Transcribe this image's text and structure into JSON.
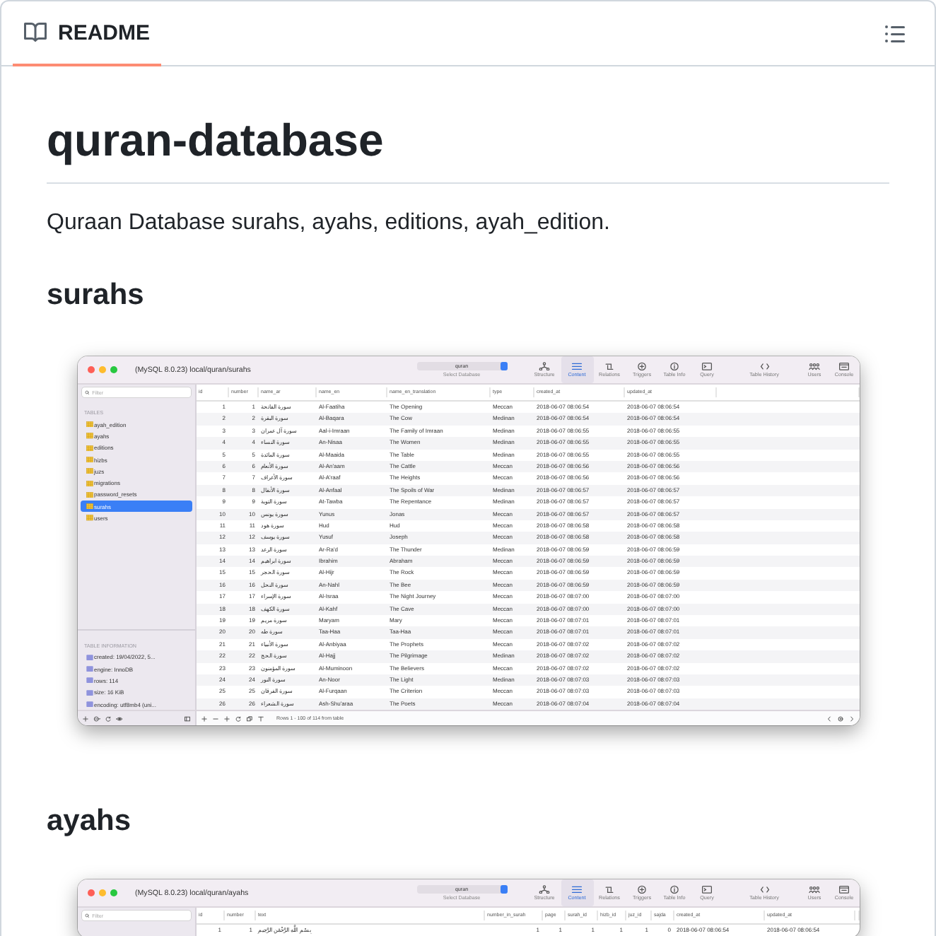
{
  "tab": {
    "label": "README",
    "selected": true
  },
  "readme": {
    "title": "quran-database",
    "description": "Quraan Database surahs, ayahs, editions, ayah_edition.",
    "sections": [
      {
        "heading": "surahs",
        "screenshot": {
          "title": "(MySQL 8.0.23) local/quran/surahs",
          "database": "quran",
          "database_label": "Select Database",
          "toolbar": [
            {
              "label": "Structure",
              "kind": "structure",
              "selected": false
            },
            {
              "label": "Content",
              "kind": "content",
              "selected": true
            },
            {
              "label": "Relations",
              "kind": "relations",
              "selected": false
            },
            {
              "label": "Triggers",
              "kind": "triggers",
              "selected": false
            },
            {
              "label": "Table Info",
              "kind": "info",
              "selected": false
            },
            {
              "label": "Query",
              "kind": "query",
              "selected": false
            },
            {
              "label": "Table History",
              "kind": "history",
              "selected": false
            },
            {
              "label": "Users",
              "kind": "users",
              "selected": false
            },
            {
              "label": "Console",
              "kind": "console",
              "selected": false
            }
          ],
          "filter_placeholder": "Filter",
          "tables_heading": "TABLES",
          "tables": [
            {
              "name": "ayah_edition",
              "selected": false
            },
            {
              "name": "ayahs",
              "selected": false
            },
            {
              "name": "editions",
              "selected": false
            },
            {
              "name": "hizbs",
              "selected": false
            },
            {
              "name": "juzs",
              "selected": false
            },
            {
              "name": "migrations",
              "selected": false
            },
            {
              "name": "password_resets",
              "selected": false
            },
            {
              "name": "surahs",
              "selected": true
            },
            {
              "name": "users",
              "selected": false
            }
          ],
          "info_heading": "TABLE INFORMATION",
          "info": [
            "created: 19/04/2022, 5...",
            "engine: InnoDB",
            "rows: 114",
            "size: 16 KiB",
            "encoding: utf8mb4 (uni..."
          ],
          "columns": [
            "id",
            "number",
            "name_ar",
            "name_en",
            "name_en_translation",
            "type",
            "created_at",
            "updated_at"
          ],
          "rows": [
            [
              "1",
              "1",
              "سورة الفاتحة",
              "Al-Faatiha",
              "The Opening",
              "Meccan",
              "2018-06-07 08:06:54",
              "2018-06-07 08:06:54"
            ],
            [
              "2",
              "2",
              "سورة البقرة",
              "Al-Baqara",
              "The Cow",
              "Medinan",
              "2018-06-07 08:06:54",
              "2018-06-07 08:06:54"
            ],
            [
              "3",
              "3",
              "سورة آل عمران",
              "Aal-i-Imraan",
              "The Family of Imraan",
              "Medinan",
              "2018-06-07 08:06:55",
              "2018-06-07 08:06:55"
            ],
            [
              "4",
              "4",
              "سورة النساء",
              "An-Nisaa",
              "The Women",
              "Medinan",
              "2018-06-07 08:06:55",
              "2018-06-07 08:06:55"
            ],
            [
              "5",
              "5",
              "سورة المائدة",
              "Al-Maaida",
              "The Table",
              "Medinan",
              "2018-06-07 08:06:55",
              "2018-06-07 08:06:55"
            ],
            [
              "6",
              "6",
              "سورة الأنعام",
              "Al-An'aam",
              "The Cattle",
              "Meccan",
              "2018-06-07 08:06:56",
              "2018-06-07 08:06:56"
            ],
            [
              "7",
              "7",
              "سورة الأعراف",
              "Al-A'raaf",
              "The Heights",
              "Meccan",
              "2018-06-07 08:06:56",
              "2018-06-07 08:06:56"
            ],
            [
              "8",
              "8",
              "سورة الأنفال",
              "Al-Anfaal",
              "The Spoils of War",
              "Medinan",
              "2018-06-07 08:06:57",
              "2018-06-07 08:06:57"
            ],
            [
              "9",
              "9",
              "سورة التوبة",
              "At-Tawba",
              "The Repentance",
              "Medinan",
              "2018-06-07 08:06:57",
              "2018-06-07 08:06:57"
            ],
            [
              "10",
              "10",
              "سورة يونس",
              "Yunus",
              "Jonas",
              "Meccan",
              "2018-06-07 08:06:57",
              "2018-06-07 08:06:57"
            ],
            [
              "11",
              "11",
              "سورة هود",
              "Hud",
              "Hud",
              "Meccan",
              "2018-06-07 08:06:58",
              "2018-06-07 08:06:58"
            ],
            [
              "12",
              "12",
              "سورة يوسف",
              "Yusuf",
              "Joseph",
              "Meccan",
              "2018-06-07 08:06:58",
              "2018-06-07 08:06:58"
            ],
            [
              "13",
              "13",
              "سورة الرعد",
              "Ar-Ra'd",
              "The Thunder",
              "Medinan",
              "2018-06-07 08:06:59",
              "2018-06-07 08:06:59"
            ],
            [
              "14",
              "14",
              "سورة ابراهيم",
              "Ibrahim",
              "Abraham",
              "Meccan",
              "2018-06-07 08:06:59",
              "2018-06-07 08:06:59"
            ],
            [
              "15",
              "15",
              "سورة الحجر",
              "Al-Hijr",
              "The Rock",
              "Meccan",
              "2018-06-07 08:06:59",
              "2018-06-07 08:06:59"
            ],
            [
              "16",
              "16",
              "سورة النحل",
              "An-Nahl",
              "The Bee",
              "Meccan",
              "2018-06-07 08:06:59",
              "2018-06-07 08:06:59"
            ],
            [
              "17",
              "17",
              "سورة الإسراء",
              "Al-Israa",
              "The Night Journey",
              "Meccan",
              "2018-06-07 08:07:00",
              "2018-06-07 08:07:00"
            ],
            [
              "18",
              "18",
              "سورة الكهف",
              "Al-Kahf",
              "The Cave",
              "Meccan",
              "2018-06-07 08:07:00",
              "2018-06-07 08:07:00"
            ],
            [
              "19",
              "19",
              "سورة مريم",
              "Maryam",
              "Mary",
              "Meccan",
              "2018-06-07 08:07:01",
              "2018-06-07 08:07:01"
            ],
            [
              "20",
              "20",
              "سورة طه",
              "Taa-Haa",
              "Taa-Haa",
              "Meccan",
              "2018-06-07 08:07:01",
              "2018-06-07 08:07:01"
            ],
            [
              "21",
              "21",
              "سورة الأنبياء",
              "Al-Anbiyaa",
              "The Prophets",
              "Meccan",
              "2018-06-07 08:07:02",
              "2018-06-07 08:07:02"
            ],
            [
              "22",
              "22",
              "سورة الحج",
              "Al-Hajj",
              "The Pilgrimage",
              "Medinan",
              "2018-06-07 08:07:02",
              "2018-06-07 08:07:02"
            ],
            [
              "23",
              "23",
              "سورة المؤمنون",
              "Al-Muminoon",
              "The Believers",
              "Meccan",
              "2018-06-07 08:07:02",
              "2018-06-07 08:07:02"
            ],
            [
              "24",
              "24",
              "سورة النور",
              "An-Noor",
              "The Light",
              "Medinan",
              "2018-06-07 08:07:03",
              "2018-06-07 08:07:03"
            ],
            [
              "25",
              "25",
              "سورة الفرقان",
              "Al-Furqaan",
              "The Criterion",
              "Meccan",
              "2018-06-07 08:07:03",
              "2018-06-07 08:07:03"
            ],
            [
              "26",
              "26",
              "سورة الشعراء",
              "Ash-Shu'araa",
              "The Poets",
              "Meccan",
              "2018-06-07 08:07:04",
              "2018-06-07 08:07:04"
            ]
          ],
          "status": "Rows 1 - 100 of 114 from table"
        }
      },
      {
        "heading": "ayahs",
        "screenshot": {
          "title": "(MySQL 8.0.23) local/quran/ayahs",
          "database": "quran",
          "database_label": "Select Database",
          "toolbar": [
            {
              "label": "Structure",
              "kind": "structure",
              "selected": false
            },
            {
              "label": "Content",
              "kind": "content",
              "selected": true
            },
            {
              "label": "Relations",
              "kind": "relations",
              "selected": false
            },
            {
              "label": "Triggers",
              "kind": "triggers",
              "selected": false
            },
            {
              "label": "Table Info",
              "kind": "info",
              "selected": false
            },
            {
              "label": "Query",
              "kind": "query",
              "selected": false
            },
            {
              "label": "Table History",
              "kind": "history",
              "selected": false
            },
            {
              "label": "Users",
              "kind": "users",
              "selected": false
            },
            {
              "label": "Console",
              "kind": "console",
              "selected": false
            }
          ],
          "filter_placeholder": "Filter",
          "columns": [
            "id",
            "number",
            "text",
            "number_in_surah",
            "page",
            "surah_id",
            "hizb_id",
            "juz_id",
            "sajda",
            "created_at",
            "updated_at"
          ],
          "rows": [
            [
              "1",
              "1",
              "بِسْمِ اللَّهِ الرَّحْمَٰنِ الرَّحِيمِ",
              "1",
              "1",
              "1",
              "1",
              "1",
              "0",
              "2018-06-07 08:06:54",
              "2018-06-07 08:06:54"
            ]
          ]
        }
      }
    ]
  }
}
